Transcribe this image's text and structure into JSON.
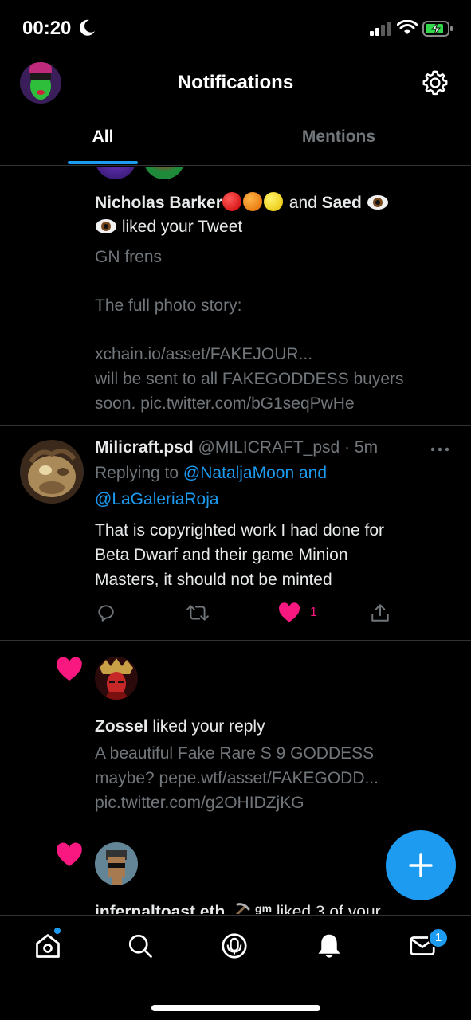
{
  "status_bar": {
    "time": "00:20"
  },
  "header": {
    "title": "Notifications"
  },
  "tabs": [
    {
      "label": "All",
      "active": true
    },
    {
      "label": "Mentions",
      "active": false
    }
  ],
  "notifications": [
    {
      "type": "like",
      "actor1": "Nicholas Barker",
      "joiner": "and",
      "actor2": "Saed",
      "action": "liked your Tweet",
      "preview_lines": [
        "GN frens",
        "The full photo story:",
        "xchain.io/asset/FAKEJOUR...",
        "will be sent to all FAKEGODDESS buyers",
        "soon. pic.twitter.com/bG1seqPwHe"
      ]
    },
    {
      "type": "reply",
      "name": "Milicraft.psd",
      "handle_meta": "@MILICRAFT_psd · 5m",
      "replying_prefix": "Replying to",
      "replying_to_line1": "@NataljaMoon and",
      "replying_to_line2": "@LaGaleriaRoja",
      "body_lines": [
        "That is copyrighted work I had done for",
        "Beta Dwarf and their game Minion",
        "Masters, it should not be minted"
      ],
      "like_count": "1"
    },
    {
      "type": "like",
      "actor": "Zossel",
      "action": "liked your reply",
      "preview_lines": [
        "A beautiful Fake Rare S 9 GODDESS",
        "maybe? pepe.wtf/asset/FAKEGODD...",
        "pic.twitter.com/g2OHIDZjKG"
      ]
    },
    {
      "type": "like",
      "actor": "infernaltoast.eth",
      "tag": "gm",
      "action": "liked 3 of your"
    }
  ],
  "bottom_nav": {
    "messages_badge": "1"
  },
  "colors": {
    "accent": "#1d9bf0",
    "like": "#f91880",
    "muted": "#71767b",
    "text": "#e7e9ea",
    "divider": "#2f3336"
  }
}
